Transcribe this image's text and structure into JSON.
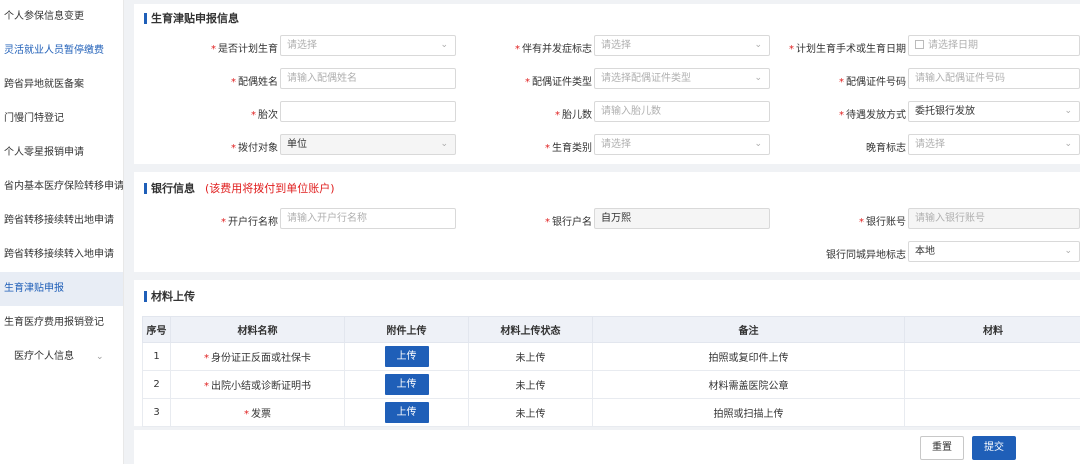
{
  "sidebar": {
    "items": [
      {
        "label": "个人参保信息变更"
      },
      {
        "label": "灵活就业人员暂停缴费"
      },
      {
        "label": "跨省异地就医备案"
      },
      {
        "label": "门慢门特登记"
      },
      {
        "label": "个人零星报销申请"
      },
      {
        "label": "省内基本医疗保险转移申请"
      },
      {
        "label": "跨省转移接续转出地申请"
      },
      {
        "label": "跨省转移接续转入地申请"
      },
      {
        "label": "生育津贴申报"
      },
      {
        "label": "生育医疗费用报销登记"
      },
      {
        "label": "医疗个人信息"
      }
    ]
  },
  "birth_info": {
    "title": "生育津贴申报信息",
    "fields": {
      "planned_birth": {
        "label": "是否计划生育",
        "placeholder": "请选择"
      },
      "complication": {
        "label": "伴有并发症标志",
        "placeholder": "请选择"
      },
      "surgery_date": {
        "label": "计划生育手术或生育日期",
        "placeholder": "请选择日期"
      },
      "spouse_name": {
        "label": "配偶姓名",
        "placeholder": "请输入配偶姓名"
      },
      "spouse_id_type": {
        "label": "配偶证件类型",
        "placeholder": "请选择配偶证件类型"
      },
      "spouse_id_no": {
        "label": "配偶证件号码",
        "placeholder": "请输入配偶证件号码"
      },
      "parity": {
        "label": "胎次",
        "placeholder": ""
      },
      "fetus_count": {
        "label": "胎儿数",
        "placeholder": "请输入胎儿数"
      },
      "payout_method": {
        "label": "待遇发放方式",
        "value": "委托银行发放"
      },
      "allocation_target": {
        "label": "拨付对象",
        "value": "单位"
      },
      "birth_category": {
        "label": "生育类别",
        "placeholder": "请选择"
      },
      "late_birth": {
        "label": "晚育标志",
        "placeholder": "请选择"
      }
    }
  },
  "bank_info": {
    "title": "银行信息",
    "note": "(该费用将拨付到单位账户)",
    "fields": {
      "bank_name": {
        "label": "开户行名称",
        "placeholder": "请输入开户行名称"
      },
      "account_name": {
        "label": "银行户名",
        "value": "自万熙"
      },
      "account_no": {
        "label": "银行账号",
        "placeholder": "请输入银行账号"
      },
      "same_city": {
        "label": "银行同城异地标志",
        "value": "本地"
      }
    }
  },
  "materials": {
    "title": "材料上传",
    "headers": [
      "序号",
      "材料名称",
      "附件上传",
      "材料上传状态",
      "备注",
      "材料"
    ],
    "rows": [
      {
        "no": "1",
        "name": "身份证正反面或社保卡",
        "upload": "上传",
        "status": "未上传",
        "remark": "拍照或复印件上传",
        "material": ""
      },
      {
        "no": "2",
        "name": "出院小结或诊断证明书",
        "upload": "上传",
        "status": "未上传",
        "remark": "材料需盖医院公章",
        "material": ""
      },
      {
        "no": "3",
        "name": "发票",
        "upload": "上传",
        "status": "未上传",
        "remark": "拍照或扫描上传",
        "material": ""
      }
    ]
  },
  "actions": {
    "reset": "重置",
    "submit": "提交"
  },
  "required_mark": "*",
  "colors": {
    "primary": "#1f5fb8",
    "required": "#e02020",
    "page_bg": "#f0f2f5"
  }
}
